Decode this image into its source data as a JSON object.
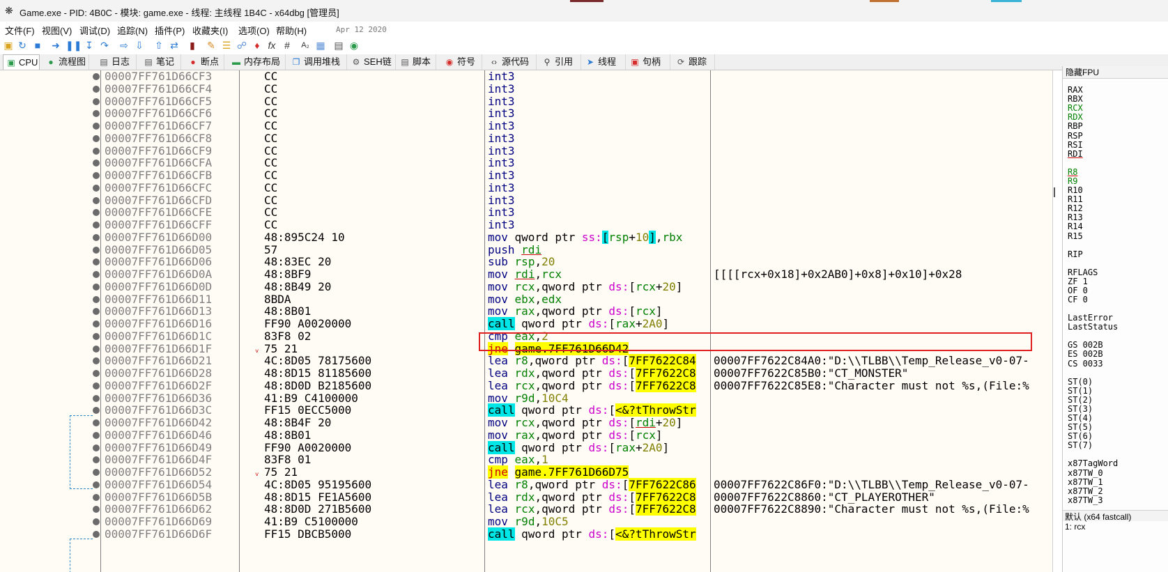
{
  "window": {
    "title": "Game.exe - PID: 4B0C - 模块: game.exe - 线程: 主线程 1B4C - x64dbg [管理员]",
    "icon": "bug-icon"
  },
  "menu": {
    "items": [
      "文件(F)",
      "视图(V)",
      "调试(D)",
      "追踪(N)",
      "插件(P)",
      "收藏夹(I)",
      "选项(O)",
      "帮助(H)"
    ],
    "date": "Apr 12 2020"
  },
  "toolbar": {
    "icons": [
      "open-icon",
      "restart-icon",
      "stop-icon",
      "run-icon",
      "pause-icon",
      "step-into-icon",
      "step-over-icon",
      "trace-into-icon",
      "trace-over-icon",
      "execute-till-return-icon",
      "run-to-user-code-icon",
      "patch-icon",
      "comment-icon",
      "label-icon",
      "bookmark-icon",
      "function-icon",
      "hash-icon",
      "strings-icon",
      "calculator-icon",
      "globe-icon"
    ],
    "fx": "fx",
    "hash": "#"
  },
  "tabs": [
    {
      "label": "CPU",
      "icon": "cpu-icon"
    },
    {
      "label": "流程图",
      "icon": "graph-icon"
    },
    {
      "label": "日志",
      "icon": "log-icon"
    },
    {
      "label": "笔记",
      "icon": "notes-icon"
    },
    {
      "label": "断点",
      "icon": "breakpoint-icon"
    },
    {
      "label": "内存布局",
      "icon": "memory-map-icon"
    },
    {
      "label": "调用堆栈",
      "icon": "call-stack-icon"
    },
    {
      "label": "SEH链",
      "icon": "seh-icon"
    },
    {
      "label": "脚本",
      "icon": "script-icon"
    },
    {
      "label": "符号",
      "icon": "symbols-icon"
    },
    {
      "label": "源代码",
      "icon": "source-icon"
    },
    {
      "label": "引用",
      "icon": "references-icon"
    },
    {
      "label": "线程",
      "icon": "threads-icon"
    },
    {
      "label": "句柄",
      "icon": "handles-icon"
    },
    {
      "label": "跟踪",
      "icon": "trace-icon"
    }
  ],
  "disasm": {
    "rows": [
      {
        "addr": "00007FF761D66CF3",
        "bytes": "CC",
        "ins": "int3",
        "cmt": ""
      },
      {
        "addr": "00007FF761D66CF4",
        "bytes": "CC",
        "ins": "int3",
        "cmt": ""
      },
      {
        "addr": "00007FF761D66CF5",
        "bytes": "CC",
        "ins": "int3",
        "cmt": ""
      },
      {
        "addr": "00007FF761D66CF6",
        "bytes": "CC",
        "ins": "int3",
        "cmt": ""
      },
      {
        "addr": "00007FF761D66CF7",
        "bytes": "CC",
        "ins": "int3",
        "cmt": ""
      },
      {
        "addr": "00007FF761D66CF8",
        "bytes": "CC",
        "ins": "int3",
        "cmt": ""
      },
      {
        "addr": "00007FF761D66CF9",
        "bytes": "CC",
        "ins": "int3",
        "cmt": ""
      },
      {
        "addr": "00007FF761D66CFA",
        "bytes": "CC",
        "ins": "int3",
        "cmt": ""
      },
      {
        "addr": "00007FF761D66CFB",
        "bytes": "CC",
        "ins": "int3",
        "cmt": ""
      },
      {
        "addr": "00007FF761D66CFC",
        "bytes": "CC",
        "ins": "int3",
        "cmt": ""
      },
      {
        "addr": "00007FF761D66CFD",
        "bytes": "CC",
        "ins": "int3",
        "cmt": ""
      },
      {
        "addr": "00007FF761D66CFE",
        "bytes": "CC",
        "ins": "int3",
        "cmt": ""
      },
      {
        "addr": "00007FF761D66CFF",
        "bytes": "CC",
        "ins": "int3",
        "cmt": ""
      },
      {
        "addr": "00007FF761D66D00",
        "bytes": "48:895C24 10",
        "ins": "mov qword ptr ss:[rsp+10],rbx",
        "cmt": ""
      },
      {
        "addr": "00007FF761D66D05",
        "bytes": "57",
        "ins": "push rdi",
        "cmt": ""
      },
      {
        "addr": "00007FF761D66D06",
        "bytes": "48:83EC 20",
        "ins": "sub rsp,20",
        "cmt": ""
      },
      {
        "addr": "00007FF761D66D0A",
        "bytes": "48:8BF9",
        "ins": "mov rdi,rcx",
        "cmt": "[[[[rcx+0x18]+0x2AB0]+0x8]+0x10]+0x28"
      },
      {
        "addr": "00007FF761D66D0D",
        "bytes": "48:8B49 20",
        "ins": "mov rcx,qword ptr ds:[rcx+20]",
        "cmt": ""
      },
      {
        "addr": "00007FF761D66D11",
        "bytes": "8BDA",
        "ins": "mov ebx,edx",
        "cmt": ""
      },
      {
        "addr": "00007FF761D66D13",
        "bytes": "48:8B01",
        "ins": "mov rax,qword ptr ds:[rcx]",
        "cmt": ""
      },
      {
        "addr": "00007FF761D66D16",
        "bytes": "FF90 A0020000",
        "ins": "call qword ptr ds:[rax+2A0]",
        "cmt": ""
      },
      {
        "addr": "00007FF761D66D1C",
        "bytes": "83F8 02",
        "ins": "cmp eax,2",
        "cmt": ""
      },
      {
        "addr": "00007FF761D66D1F",
        "bytes": "75 21",
        "ins": "jne game.7FF761D66D42",
        "cmt": ""
      },
      {
        "addr": "00007FF761D66D21",
        "bytes": "4C:8D05 78175600",
        "ins": "lea r8,qword ptr ds:[7FF7622C84",
        "cmt": "00007FF7622C84A0:\"D:\\\\TLBB\\\\Temp_Release_v0-07-"
      },
      {
        "addr": "00007FF761D66D28",
        "bytes": "48:8D15 81185600",
        "ins": "lea rdx,qword ptr ds:[7FF7622C8",
        "cmt": "00007FF7622C85B0:\"CT_MONSTER\""
      },
      {
        "addr": "00007FF761D66D2F",
        "bytes": "48:8D0D B2185600",
        "ins": "lea rcx,qword ptr ds:[7FF7622C8",
        "cmt": "00007FF7622C85E8:\"Character must not %s,(File:%"
      },
      {
        "addr": "00007FF761D66D36",
        "bytes": "41:B9 C4100000",
        "ins": "mov r9d,10C4",
        "cmt": ""
      },
      {
        "addr": "00007FF761D66D3C",
        "bytes": "FF15 0ECC5000",
        "ins": "call qword ptr ds:[<&?tThrowStr",
        "cmt": ""
      },
      {
        "addr": "00007FF761D66D42",
        "bytes": "48:8B4F 20",
        "ins": "mov rcx,qword ptr ds:[rdi+20]",
        "cmt": ""
      },
      {
        "addr": "00007FF761D66D46",
        "bytes": "48:8B01",
        "ins": "mov rax,qword ptr ds:[rcx]",
        "cmt": ""
      },
      {
        "addr": "00007FF761D66D49",
        "bytes": "FF90 A0020000",
        "ins": "call qword ptr ds:[rax+2A0]",
        "cmt": ""
      },
      {
        "addr": "00007FF761D66D4F",
        "bytes": "83F8 01",
        "ins": "cmp eax,1",
        "cmt": ""
      },
      {
        "addr": "00007FF761D66D52",
        "bytes": "75 21",
        "ins": "jne game.7FF761D66D75",
        "cmt": ""
      },
      {
        "addr": "00007FF761D66D54",
        "bytes": "4C:8D05 95195600",
        "ins": "lea r8,qword ptr ds:[7FF7622C86",
        "cmt": "00007FF7622C86F0:\"D:\\\\TLBB\\\\Temp_Release_v0-07-"
      },
      {
        "addr": "00007FF761D66D5B",
        "bytes": "48:8D15 FE1A5600",
        "ins": "lea rdx,qword ptr ds:[7FF7622C8",
        "cmt": "00007FF7622C8860:\"CT_PLAYEROTHER\""
      },
      {
        "addr": "00007FF761D66D62",
        "bytes": "48:8D0D 271B5600",
        "ins": "lea rcx,qword ptr ds:[7FF7622C8",
        "cmt": "00007FF7622C8890:\"Character must not %s,(File:%"
      },
      {
        "addr": "00007FF761D66D69",
        "bytes": "41:B9 C5100000",
        "ins": "mov r9d,10C5",
        "cmt": ""
      },
      {
        "addr": "00007FF761D66D6F",
        "bytes": "FF15 DBCB5000",
        "ins": "call qword ptr ds:[<&?tThrowStr",
        "cmt": ""
      }
    ]
  },
  "registers": {
    "header": "隐藏FPU",
    "gp": [
      "RAX",
      "RBX",
      "RCX",
      "RDX",
      "RBP",
      "RSP",
      "RSI",
      "RDI"
    ],
    "ext": [
      "R8",
      "R9",
      "R10",
      "R11",
      "R12",
      "R13",
      "R14",
      "R15"
    ],
    "rip": "RIP",
    "flags": [
      "RFLAGS",
      "ZF 1",
      "OF 0",
      "CF 0"
    ],
    "last": [
      "LastError",
      "LastStatus"
    ],
    "seg": [
      "GS 002B",
      "ES 002B",
      "CS 0033"
    ],
    "st": [
      "ST(0)",
      "ST(1)",
      "ST(2)",
      "ST(3)",
      "ST(4)",
      "ST(5)",
      "ST(6)",
      "ST(7)"
    ],
    "x87": [
      "x87TagWord",
      "x87TW_0",
      "x87TW_1",
      "x87TW_2",
      "x87TW_3"
    ],
    "footer": "默认 (x64 fastcall)",
    "callarg": "1: rcx"
  },
  "colors": {
    "accent_cyan": "#00e5e5",
    "accent_yellow": "#ffff00",
    "annotation_red": "#e02020",
    "address_gray": "#808080",
    "background": "#fffbf5"
  }
}
